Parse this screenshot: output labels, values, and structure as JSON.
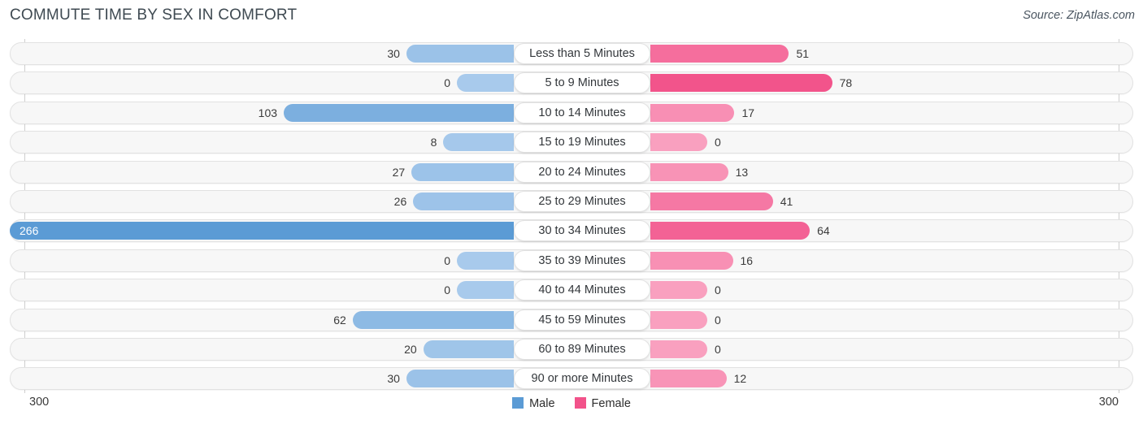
{
  "header": {
    "title": "COMMUTE TIME BY SEX IN COMFORT",
    "source": "Source: ZipAtlas.com"
  },
  "legend": {
    "items": [
      {
        "label": "Male",
        "color": "#5B9BD5"
      },
      {
        "label": "Female",
        "color": "#F2528A"
      }
    ]
  },
  "axis": {
    "left_end": "300",
    "right_end": "300",
    "max": 300
  },
  "colors": {
    "male_light": "#A8CAEC",
    "male_mid": "#8AB6E2",
    "male_strong": "#5B9BD5",
    "female_light": "#F9A0BF",
    "female_mid": "#F77BA3",
    "female_strong": "#F2528A",
    "track_fill": "#f7f7f7",
    "track_border": "#e2e2e2",
    "axis_rule": "#cfcfcf"
  },
  "chart_data": {
    "type": "bar",
    "subtype": "diverging-bidirectional",
    "title": "COMMUTE TIME BY SEX IN COMFORT",
    "xlabel": "",
    "ylabel": "",
    "xlim": [
      300,
      300
    ],
    "grid": false,
    "legend_position": "bottom-center",
    "categories": [
      "Less than 5 Minutes",
      "5 to 9 Minutes",
      "10 to 14 Minutes",
      "15 to 19 Minutes",
      "20 to 24 Minutes",
      "25 to 29 Minutes",
      "30 to 34 Minutes",
      "35 to 39 Minutes",
      "40 to 44 Minutes",
      "45 to 59 Minutes",
      "60 to 89 Minutes",
      "90 or more Minutes"
    ],
    "series": [
      {
        "name": "Male",
        "values": [
          30,
          0,
          103,
          8,
          27,
          26,
          266,
          0,
          0,
          62,
          20,
          30
        ]
      },
      {
        "name": "Female",
        "values": [
          51,
          78,
          17,
          0,
          13,
          41,
          64,
          16,
          0,
          0,
          0,
          12
        ]
      }
    ]
  },
  "rows": [
    {
      "label": "Less than 5 Minutes",
      "male": "30",
      "female": "51"
    },
    {
      "label": "5 to 9 Minutes",
      "male": "0",
      "female": "78"
    },
    {
      "label": "10 to 14 Minutes",
      "male": "103",
      "female": "17"
    },
    {
      "label": "15 to 19 Minutes",
      "male": "8",
      "female": "0"
    },
    {
      "label": "20 to 24 Minutes",
      "male": "27",
      "female": "13"
    },
    {
      "label": "25 to 29 Minutes",
      "male": "26",
      "female": "41"
    },
    {
      "label": "30 to 34 Minutes",
      "male": "266",
      "female": "64"
    },
    {
      "label": "35 to 39 Minutes",
      "male": "0",
      "female": "16"
    },
    {
      "label": "40 to 44 Minutes",
      "male": "0",
      "female": "0"
    },
    {
      "label": "45 to 59 Minutes",
      "male": "62",
      "female": "0"
    },
    {
      "label": "60 to 89 Minutes",
      "male": "20",
      "female": "0"
    },
    {
      "label": "90 or more Minutes",
      "male": "30",
      "female": "12"
    }
  ]
}
